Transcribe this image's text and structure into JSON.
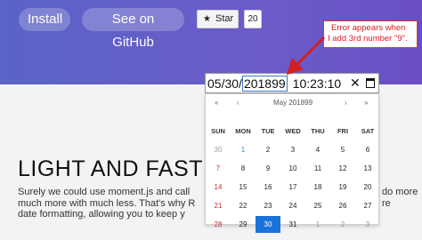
{
  "hero": {
    "install_label": "Install",
    "github_label": "See on GitHub",
    "star_label": "Star",
    "star_icon": "star-icon",
    "star_count": "20",
    "gradient_colors": [
      "#5a63c6",
      "#6a4fc4"
    ]
  },
  "annotation": {
    "line1": "Error appears when",
    "line2": "I add 3rd number \"9\".",
    "color": "#d21f1f"
  },
  "datetime": {
    "month": "05",
    "day": "30",
    "year": "201899",
    "hour": "10",
    "minute": "23",
    "second": "10",
    "date_sep": "/",
    "time_sep": ":",
    "clear_icon": "close-icon",
    "calendar_icon": "calendar-icon"
  },
  "calendar": {
    "month_label": "May 201899",
    "prev_year": "«",
    "prev_month": "‹",
    "next_month": "›",
    "next_year": "»",
    "weekdays": [
      "SUN",
      "MON",
      "TUE",
      "WED",
      "THU",
      "FRI",
      "SAT"
    ],
    "weeks": [
      [
        "30",
        "1",
        "2",
        "3",
        "4",
        "5",
        "6"
      ],
      [
        "7",
        "8",
        "9",
        "10",
        "11",
        "12",
        "13"
      ],
      [
        "14",
        "15",
        "16",
        "17",
        "18",
        "19",
        "20"
      ],
      [
        "21",
        "22",
        "23",
        "24",
        "25",
        "26",
        "27"
      ],
      [
        "28",
        "29",
        "30",
        "31",
        "1",
        "2",
        "3"
      ]
    ],
    "selected_color": "#1a73d9"
  },
  "content": {
    "heading": "LIGHT AND FAST",
    "paragraph": "Surely we could use moment.js and call much more with much less. That's why R date formatting, allowing you to keep y",
    "right_text": "do more re"
  }
}
